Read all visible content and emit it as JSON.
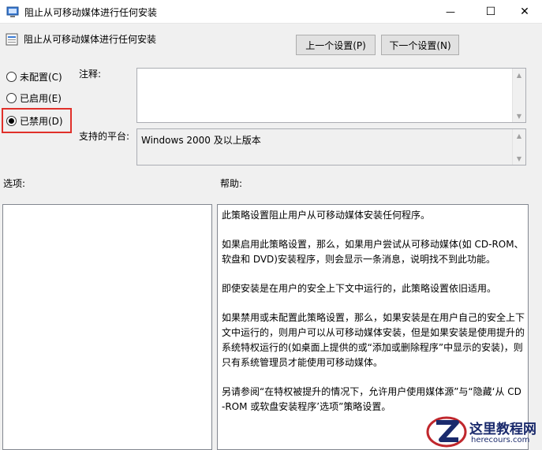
{
  "window": {
    "title": "阻止从可移动媒体进行任何安装",
    "minimize_glyph": "—",
    "maximize_glyph": "☐",
    "close_glyph": "✕"
  },
  "header": {
    "policy_title": "阻止从可移动媒体进行任何安装",
    "prev_button": "上一个设置(P)",
    "next_button": "下一个设置(N)"
  },
  "state": {
    "options": [
      {
        "label": "未配置(C)",
        "checked": false
      },
      {
        "label": "已启用(E)",
        "checked": false
      },
      {
        "label": "已禁用(D)",
        "checked": true
      }
    ],
    "highlight_color": "#e0302a"
  },
  "comment": {
    "label": "注释:",
    "value": ""
  },
  "platform": {
    "label": "支持的平台:",
    "value": "Windows 2000 及以上版本"
  },
  "options_section": {
    "label": "选项:"
  },
  "help_section": {
    "label": "帮助:",
    "paragraphs": [
      "此策略设置阻止用户从可移动媒体安装任何程序。",
      "如果启用此策略设置，那么，如果用户尝试从可移动媒体(如 CD-ROM、软盘和 DVD)安装程序，则会显示一条消息，说明找不到此功能。",
      "即使安装是在用户的安全上下文中运行的，此策略设置依旧适用。",
      "如果禁用或未配置此策略设置，那么，如果安装是在用户自己的安全上下文中运行的，则用户可以从可移动媒体安装，但是如果安装是使用提升的系统特权运行的(如桌面上提供的或“添加或删除程序”中显示的安装)，则只有系统管理员才能使用可移动媒体。",
      "另请参阅“在特权被提升的情况下，允许用户使用媒体源”与“隐藏‘从 CD-ROM 或软盘安装程序’选项”策略设置。"
    ]
  },
  "watermark": {
    "title": "这里教程网",
    "url": "herecours.com"
  },
  "colors": {
    "window_bg": "#f0f0f0",
    "brand": "#1a2a6c",
    "logo_red": "#c0272d"
  }
}
